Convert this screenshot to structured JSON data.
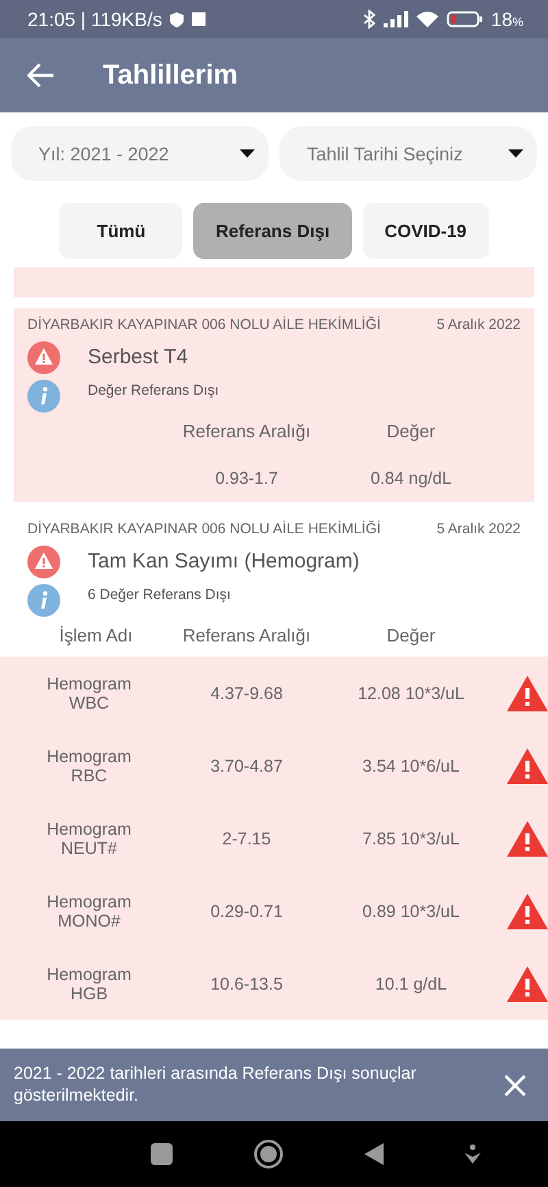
{
  "status_bar": {
    "time": "21:05 | 119KB/s",
    "battery": "18",
    "battery_unit": "%"
  },
  "header": {
    "title": "Tahlillerim"
  },
  "filters": [
    {
      "label": "Yıl: 2021 - 2022"
    },
    {
      "label": "Tahlil Tarihi Seçiniz"
    }
  ],
  "tabs": [
    {
      "label": "Tümü",
      "selected": false
    },
    {
      "label": "Referans Dışı",
      "selected": true
    },
    {
      "label": "COVID-19",
      "selected": false
    }
  ],
  "results": [
    {
      "kind": "single",
      "out_of_range": true,
      "facility": "DİYARBAKIR KAYAPINAR 006 NOLU AİLE HEKİMLİĞİ",
      "date": "5 Aralık 2022",
      "title": "Serbest T4",
      "note": "Değer Referans Dışı",
      "columns": [
        "Referans Aralığı",
        "Değer"
      ],
      "range": "0.93-1.7",
      "value": "0.84 ng/dL"
    },
    {
      "kind": "table",
      "out_of_range": false,
      "facility": "DİYARBAKIR KAYAPINAR 006 NOLU AİLE HEKİMLİĞİ",
      "date": "5 Aralık 2022",
      "title": "Tam Kan Sayımı (Hemogram)",
      "note": "6 Değer Referans Dışı",
      "columns": [
        "İşlem Adı",
        "Referans Aralığı",
        "Değer"
      ],
      "rows": [
        {
          "name": "Hemogram WBC",
          "range": "4.37-9.68",
          "value": "12.08 10*3/uL",
          "out_of_range": true
        },
        {
          "name": "Hemogram RBC",
          "range": "3.70-4.87",
          "value": "3.54 10*6/uL",
          "out_of_range": true
        },
        {
          "name": "Hemogram NEUT#",
          "range": "2-7.15",
          "value": "7.85 10*3/uL",
          "out_of_range": true
        },
        {
          "name": "Hemogram MONO#",
          "range": "0.29-0.71",
          "value": "0.89 10*3/uL",
          "out_of_range": true
        },
        {
          "name": "Hemogram HGB",
          "range": "10.6-13.5",
          "value": "10.1 g/dL",
          "out_of_range": true
        }
      ]
    }
  ],
  "snackbar": {
    "message": "2021 - 2022 tarihleri arasında Referans Dışı sonuçlar gösterilmektedir."
  }
}
